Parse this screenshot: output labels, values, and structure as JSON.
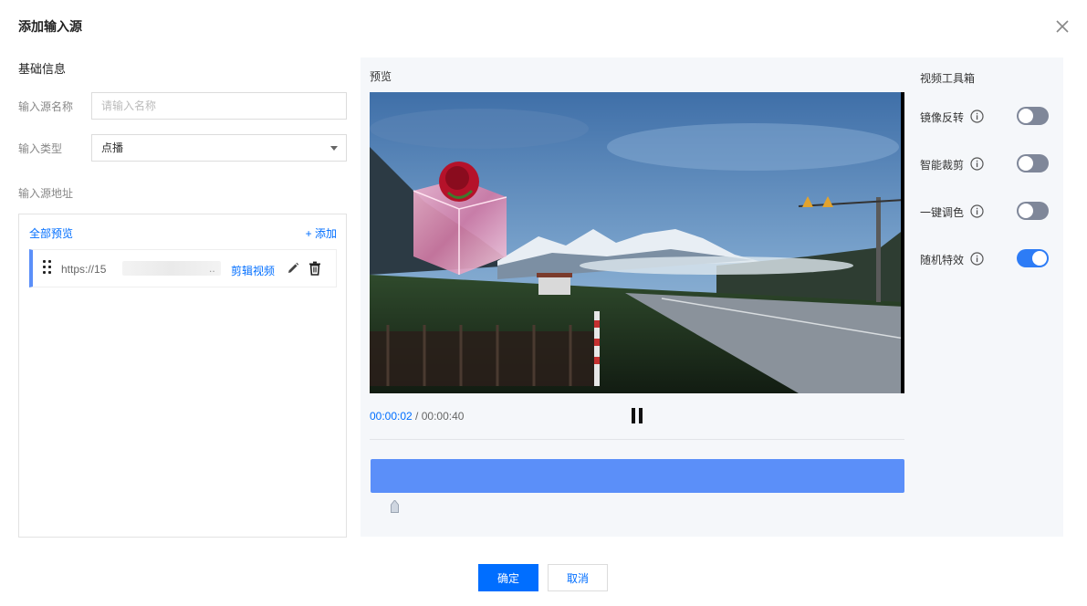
{
  "dialog": {
    "title": "添加输入源",
    "close_icon": "close-icon"
  },
  "basic_info": {
    "section_title": "基础信息",
    "name_label": "输入源名称",
    "name_value": "",
    "name_placeholder": "请输入名称",
    "type_label": "输入类型",
    "type_value": "点播",
    "address_label": "输入源地址"
  },
  "sources": {
    "preview_all": "全部预览",
    "add_label": "+ 添加",
    "items": [
      {
        "url": "https://15",
        "ellipsis": "..",
        "clip_label": "剪辑视频"
      }
    ]
  },
  "preview": {
    "label": "预览",
    "current_time": "00:00:02",
    "separator": " / ",
    "total_time": "00:00:40"
  },
  "toolbox": {
    "title": "视频工具箱",
    "tools": [
      {
        "label": "镜像反转",
        "enabled": false
      },
      {
        "label": "智能裁剪",
        "enabled": false
      },
      {
        "label": "一键调色",
        "enabled": false
      },
      {
        "label": "随机特效",
        "enabled": true
      }
    ]
  },
  "footer": {
    "ok_label": "确定",
    "cancel_label": "取消"
  },
  "colors": {
    "accent": "#006eff",
    "timeline": "#5b8ff9",
    "switch_on": "#2d7cf6",
    "switch_off": "#7f8799"
  }
}
